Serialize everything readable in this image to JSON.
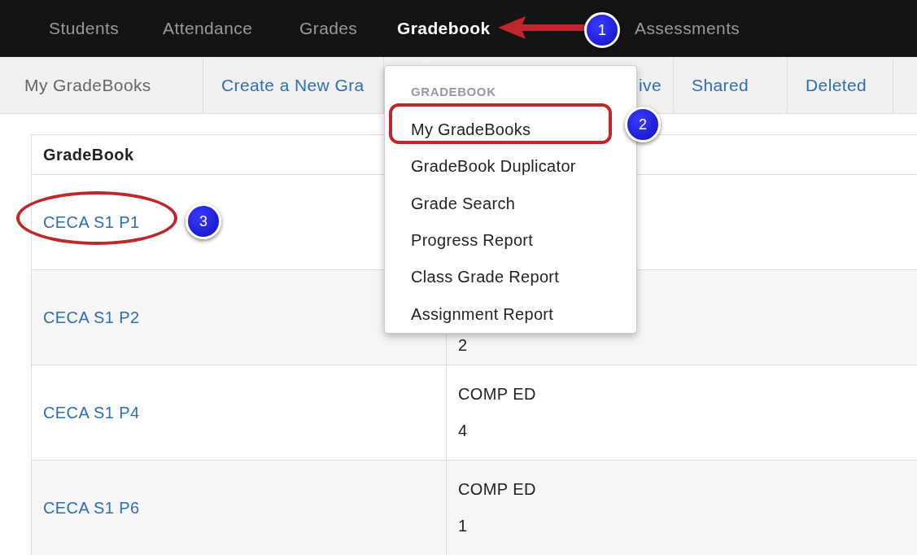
{
  "top_nav": [
    {
      "label": "Students",
      "selected": false
    },
    {
      "label": "Attendance",
      "selected": false
    },
    {
      "label": "Grades",
      "selected": false
    },
    {
      "label": "Gradebook",
      "selected": true
    },
    {
      "label": "Assessments",
      "selected": false
    }
  ],
  "sub_nav": [
    {
      "label": "My GradeBooks",
      "kind": "current"
    },
    {
      "label": "Create a New Gra",
      "kind": "link"
    },
    {
      "label": "ive",
      "kind": "link"
    },
    {
      "label": "Shared",
      "kind": "link"
    },
    {
      "label": "Deleted",
      "kind": "link"
    }
  ],
  "dropdown": {
    "header": "GRADEBOOK",
    "items": [
      "My GradeBooks",
      "GradeBook Duplicator",
      "Grade Search",
      "Progress Report",
      "Class Grade Report",
      "Assignment Report"
    ]
  },
  "table": {
    "columns": [
      "GradeBook"
    ],
    "rows": [
      {
        "name": "CECA S1 P1"
      },
      {
        "name": "CECA S1 P2",
        "details": [
          "2"
        ]
      },
      {
        "name": "CECA S1 P4",
        "details": [
          "COMP ED",
          "4"
        ]
      },
      {
        "name": "CECA S1 P6",
        "details": [
          "COMP ED",
          "1"
        ]
      }
    ]
  },
  "annotations": [
    {
      "kind": "arrow"
    },
    {
      "kind": "badge",
      "label": "1"
    },
    {
      "kind": "ring"
    },
    {
      "kind": "badge",
      "label": "2"
    },
    {
      "kind": "ring"
    },
    {
      "kind": "badge",
      "label": "3"
    }
  ]
}
